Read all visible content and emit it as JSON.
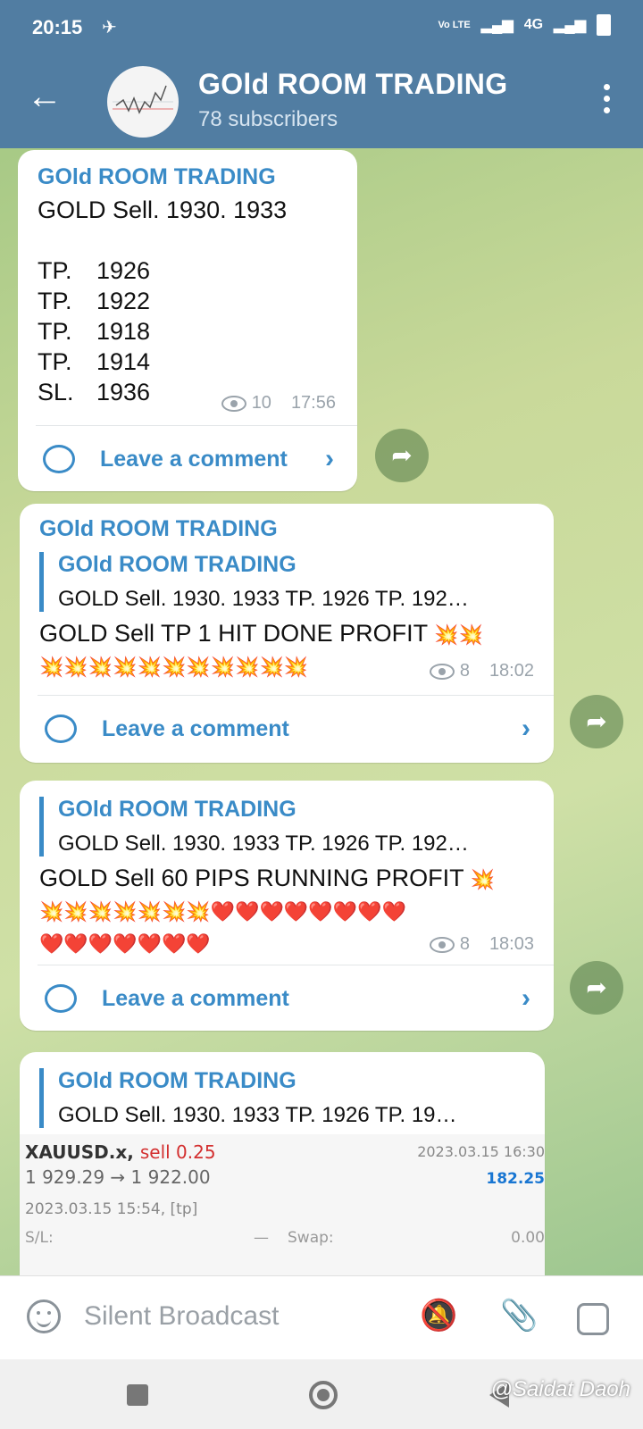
{
  "status": {
    "time": "20:15",
    "network": "4G",
    "lte": "Vo LTE"
  },
  "header": {
    "title": "GOld ROOM TRADING",
    "subtitle": "78 subscribers"
  },
  "messages": [
    {
      "sender": "GOld ROOM TRADING",
      "line1": "GOLD Sell. 1930. 1933",
      "tps": [
        {
          "label": "TP.",
          "value": "1926"
        },
        {
          "label": "TP.",
          "value": "1922"
        },
        {
          "label": "TP.",
          "value": "1918"
        },
        {
          "label": "TP.",
          "value": "1914"
        },
        {
          "label": "SL.",
          "value": "1936"
        }
      ],
      "views": "10",
      "time": "17:56",
      "comment": "Leave a comment"
    },
    {
      "sender": "GOld ROOM TRADING",
      "reply_sender": "GOld ROOM TRADING",
      "reply_text": "GOLD Sell. 1930. 1933  TP.    1926 TP.    192…",
      "text": "GOLD Sell TP 1 HIT DONE PROFIT",
      "views": "8",
      "time": "18:02",
      "comment": "Leave a comment"
    },
    {
      "reply_sender": "GOld ROOM TRADING",
      "reply_text": "GOLD Sell. 1930. 1933  TP.    1926 TP.    192…",
      "text": "GOLD Sell 60 PIPS RUNNING PROFIT",
      "views": "8",
      "time": "18:03",
      "comment": "Leave a comment"
    },
    {
      "reply_sender": "GOld ROOM TRADING",
      "reply_text": "GOLD Sell. 1930. 1933  TP.    1926 TP.    19…",
      "trade": {
        "symbol": "XAUUSD.x,",
        "side": "sell 0.25",
        "close_time": "2023.03.15 16:30",
        "prices": "1 929.29 → 1 922.00",
        "profit": "182.25",
        "open_time": "2023.03.15 15:54, [tp]",
        "sl_label": "S/L:",
        "sl_value": "—",
        "swap_label": "Swap:",
        "swap_value": "0.00"
      }
    }
  ],
  "input": {
    "placeholder": "Silent Broadcast"
  },
  "watermark": "@Saidat Daoh"
}
